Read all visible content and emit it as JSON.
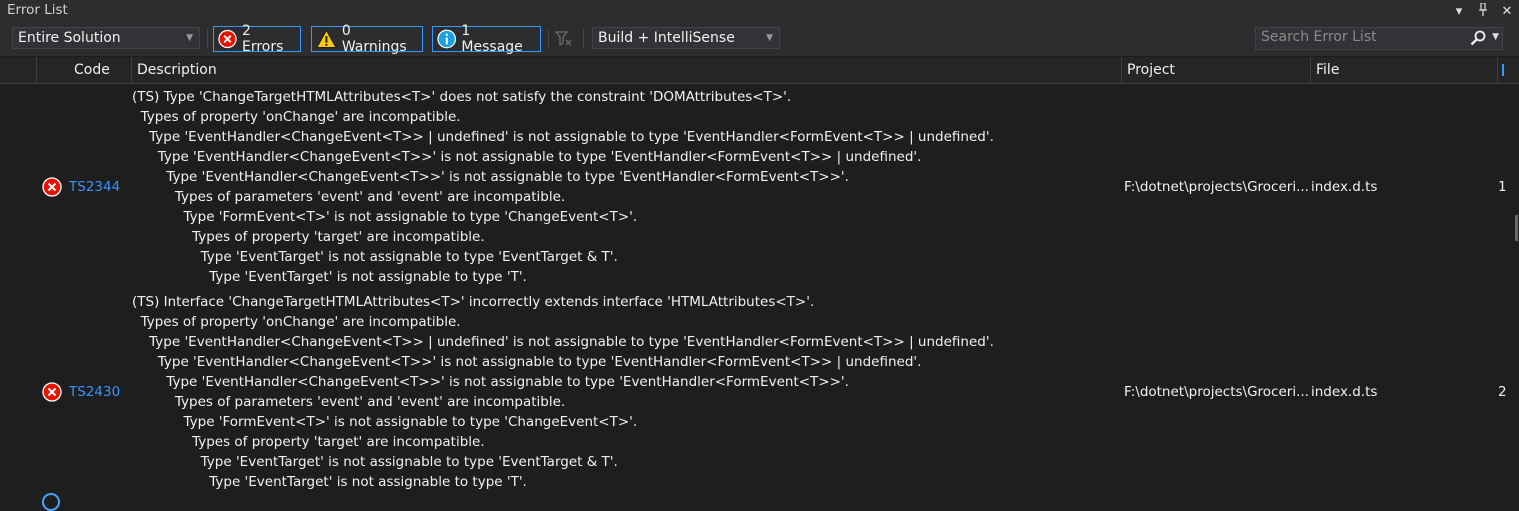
{
  "window": {
    "title": "Error List"
  },
  "toolbar": {
    "scope": "Entire Solution",
    "errors_label": "2 Errors",
    "warnings_label": "0 Warnings",
    "messages_label": "1 Message",
    "build_filter": "Build + IntelliSense",
    "search_placeholder": "Search Error List"
  },
  "columns": {
    "code": "Code",
    "description": "Description",
    "project": "Project",
    "file": "File"
  },
  "rows": [
    {
      "code": "TS2344",
      "description_lines": [
        "(TS) Type 'ChangeTargetHTMLAttributes<T>' does not satisfy the constraint 'DOMAttributes<T>'.",
        "  Types of property 'onChange' are incompatible.",
        "    Type 'EventHandler<ChangeEvent<T>> | undefined' is not assignable to type 'EventHandler<FormEvent<T>> | undefined'.",
        "      Type 'EventHandler<ChangeEvent<T>>' is not assignable to type 'EventHandler<FormEvent<T>> | undefined'.",
        "        Type 'EventHandler<ChangeEvent<T>>' is not assignable to type 'EventHandler<FormEvent<T>>'.",
        "          Types of parameters 'event' and 'event' are incompatible.",
        "            Type 'FormEvent<T>' is not assignable to type 'ChangeEvent<T>'.",
        "              Types of property 'target' are incompatible.",
        "                Type 'EventTarget' is not assignable to type 'EventTarget & T'.",
        "                  Type 'EventTarget' is not assignable to type 'T'."
      ],
      "project": "F:\\dotnet\\projects\\Groceri...",
      "file": "index.d.ts",
      "line": "1"
    },
    {
      "code": "TS2430",
      "description_lines": [
        "(TS) Interface 'ChangeTargetHTMLAttributes<T>' incorrectly extends interface 'HTMLAttributes<T>'.",
        "  Types of property 'onChange' are incompatible.",
        "    Type 'EventHandler<ChangeEvent<T>> | undefined' is not assignable to type 'EventHandler<FormEvent<T>> | undefined'.",
        "      Type 'EventHandler<ChangeEvent<T>>' is not assignable to type 'EventHandler<FormEvent<T>> | undefined'.",
        "        Type 'EventHandler<ChangeEvent<T>>' is not assignable to type 'EventHandler<FormEvent<T>>'.",
        "          Types of parameters 'event' and 'event' are incompatible.",
        "            Type 'FormEvent<T>' is not assignable to type 'ChangeEvent<T>'.",
        "              Types of property 'target' are incompatible.",
        "                Type 'EventTarget' is not assignable to type 'EventTarget & T'.",
        "                  Type 'EventTarget' is not assignable to type 'T'."
      ],
      "project": "F:\\dotnet\\projects\\Groceri...",
      "file": "index.d.ts",
      "line": "2"
    }
  ],
  "colors": {
    "accent": "#3399ff",
    "error": "#e51400",
    "warning": "#ffcc00",
    "info": "#1ba1e2",
    "link": "#3794ff"
  }
}
